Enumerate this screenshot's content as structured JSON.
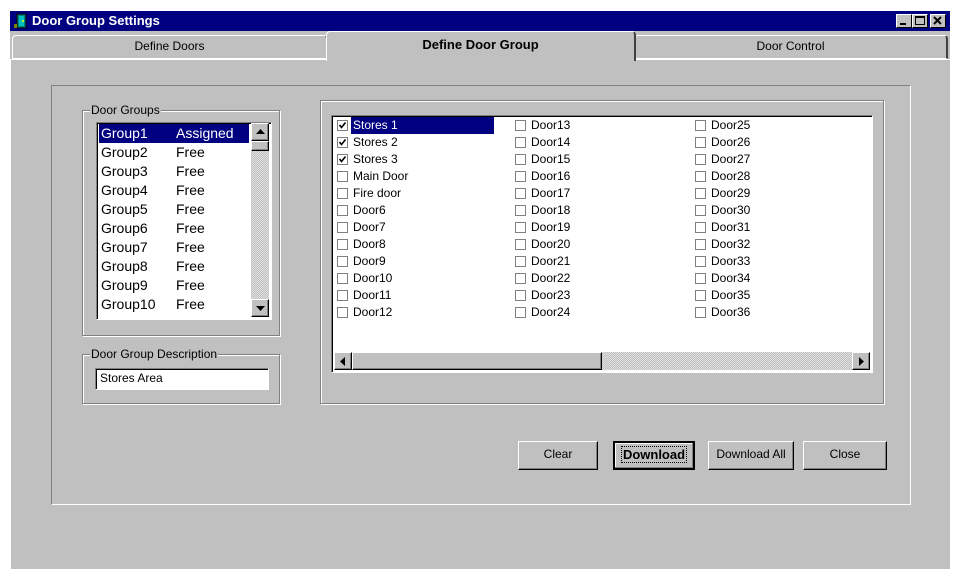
{
  "window": {
    "title": "Door Group Settings"
  },
  "title_buttons": {
    "minimize": "minimize-icon",
    "maximize": "maximize-icon",
    "close": "close-icon"
  },
  "tabs": [
    {
      "label": "Define Doors",
      "active": false
    },
    {
      "label": "Define Door Group",
      "active": true
    },
    {
      "label": "Door Control",
      "active": false
    }
  ],
  "door_groups": {
    "legend": "Door Groups",
    "items": [
      {
        "name": "Group1",
        "status": "Assigned",
        "selected": true
      },
      {
        "name": "Group2",
        "status": "Free"
      },
      {
        "name": "Group3",
        "status": "Free"
      },
      {
        "name": "Group4",
        "status": "Free"
      },
      {
        "name": "Group5",
        "status": "Free"
      },
      {
        "name": "Group6",
        "status": "Free"
      },
      {
        "name": "Group7",
        "status": "Free"
      },
      {
        "name": "Group8",
        "status": "Free"
      },
      {
        "name": "Group9",
        "status": "Free"
      },
      {
        "name": "Group10",
        "status": "Free"
      }
    ]
  },
  "description": {
    "legend": "Door Group Description",
    "value": "Stores Area"
  },
  "doors": {
    "columns": [
      [
        {
          "label": "Stores 1",
          "checked": true,
          "selected": true
        },
        {
          "label": "Stores 2",
          "checked": true
        },
        {
          "label": "Stores 3",
          "checked": true
        },
        {
          "label": "Main Door",
          "checked": false
        },
        {
          "label": "Fire door",
          "checked": false
        },
        {
          "label": "Door6",
          "checked": false
        },
        {
          "label": "Door7",
          "checked": false
        },
        {
          "label": "Door8",
          "checked": false
        },
        {
          "label": "Door9",
          "checked": false
        },
        {
          "label": "Door10",
          "checked": false
        },
        {
          "label": "Door11",
          "checked": false
        },
        {
          "label": "Door12",
          "checked": false
        }
      ],
      [
        {
          "label": "Door13",
          "checked": false
        },
        {
          "label": "Door14",
          "checked": false
        },
        {
          "label": "Door15",
          "checked": false
        },
        {
          "label": "Door16",
          "checked": false
        },
        {
          "label": "Door17",
          "checked": false
        },
        {
          "label": "Door18",
          "checked": false
        },
        {
          "label": "Door19",
          "checked": false
        },
        {
          "label": "Door20",
          "checked": false
        },
        {
          "label": "Door21",
          "checked": false
        },
        {
          "label": "Door22",
          "checked": false
        },
        {
          "label": "Door23",
          "checked": false
        },
        {
          "label": "Door24",
          "checked": false
        }
      ],
      [
        {
          "label": "Door25",
          "checked": false
        },
        {
          "label": "Door26",
          "checked": false
        },
        {
          "label": "Door27",
          "checked": false
        },
        {
          "label": "Door28",
          "checked": false
        },
        {
          "label": "Door29",
          "checked": false
        },
        {
          "label": "Door30",
          "checked": false
        },
        {
          "label": "Door31",
          "checked": false
        },
        {
          "label": "Door32",
          "checked": false
        },
        {
          "label": "Door33",
          "checked": false
        },
        {
          "label": "Door34",
          "checked": false
        },
        {
          "label": "Door35",
          "checked": false
        },
        {
          "label": "Door36",
          "checked": false
        }
      ]
    ]
  },
  "buttons": {
    "clear": "Clear",
    "download": "Download",
    "download_all": "Download All",
    "close": "Close"
  },
  "colors": {
    "face": "#c0c0c0",
    "title_bar": "#000080",
    "selection": "#000080",
    "field": "#ffffff"
  }
}
